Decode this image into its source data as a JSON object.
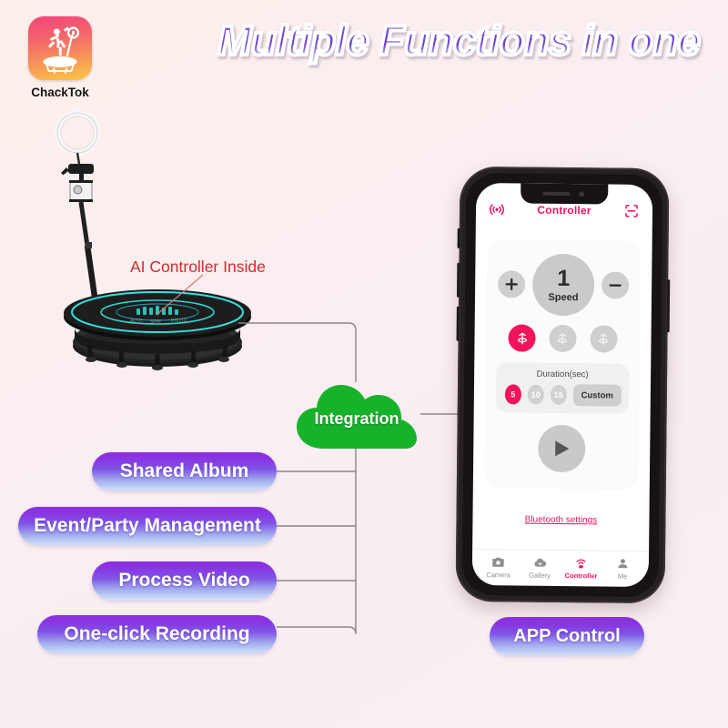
{
  "headline": "Multiple Functions in one",
  "app_icon": {
    "name": "ChackTok",
    "icon": "chacktok-app-icon"
  },
  "device": {
    "callout": "AI Controller Inside",
    "icon": "360-photo-booth-turntable"
  },
  "integration": {
    "label": "Integration",
    "color": "#16b32a"
  },
  "features": [
    {
      "label": "Shared Album"
    },
    {
      "label": "Event/Party Management"
    },
    {
      "label": "Process Video"
    },
    {
      "label": "One-click Recording"
    }
  ],
  "app_control_label": "APP Control",
  "phone": {
    "header": {
      "left_icon": "broadcast-signal-icon",
      "title": "Controller",
      "right_icon": "scan-frame-icon"
    },
    "speed": {
      "increase_label": "+",
      "decrease_label": "−",
      "value": "1",
      "caption": "Speed"
    },
    "rotation_modes": [
      {
        "name": "rotation-mode-1",
        "active": true
      },
      {
        "name": "rotation-mode-2",
        "active": false
      },
      {
        "name": "rotation-mode-3",
        "active": false
      }
    ],
    "duration": {
      "title": "Duration(sec)",
      "options": [
        {
          "label": "5",
          "active": true
        },
        {
          "label": "10",
          "active": false
        },
        {
          "label": "15",
          "active": false
        },
        {
          "label": "Custom",
          "active": false
        }
      ]
    },
    "play_icon": "play-icon",
    "bluetooth_link": "Bluetooth settings",
    "tabs": [
      {
        "label": "Camera",
        "icon": "camera-icon",
        "active": false
      },
      {
        "label": "Gallery",
        "icon": "cloud-gallery-icon",
        "active": false
      },
      {
        "label": "Controller",
        "icon": "controller-signal-icon",
        "active": true
      },
      {
        "label": "Me",
        "icon": "person-icon",
        "active": false
      }
    ]
  },
  "colors": {
    "accent_pink": "#f2145a",
    "green": "#16b32a",
    "purple": "#8b2fe0",
    "callout_red": "#d22b2b",
    "background": "#f9eef1"
  }
}
